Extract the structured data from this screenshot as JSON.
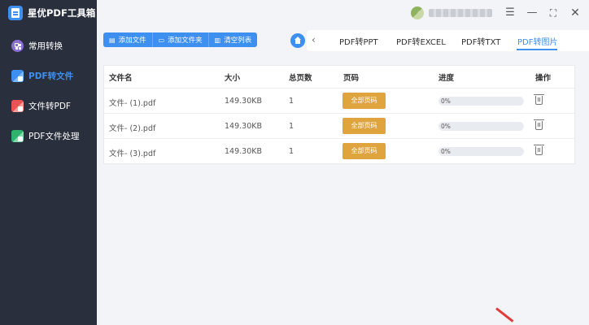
{
  "app": {
    "title": "星优PDF工具箱"
  },
  "sidebar": {
    "items": [
      {
        "label": "常用转换",
        "icon": "grid-icon"
      },
      {
        "label": "PDF转文件",
        "icon": "pdf-to-file-icon",
        "active": true
      },
      {
        "label": "文件转PDF",
        "icon": "file-to-pdf-icon"
      },
      {
        "label": "PDF文件处理",
        "icon": "pdf-process-icon"
      }
    ]
  },
  "window_controls": [
    "settings-icon",
    "minimize-icon",
    "maximize-icon",
    "close-icon"
  ],
  "toolbar": {
    "add_file": "添加文件",
    "add_folder": "添加文件夹",
    "clear_list": "清空列表"
  },
  "tabs": [
    "PDF转PPT",
    "PDF转EXCEL",
    "PDF转TXT",
    "PDF转图片"
  ],
  "active_tab": "PDF转图片",
  "table": {
    "headers": [
      "文件名",
      "大小",
      "总页数",
      "页码",
      "进度",
      "操作"
    ],
    "rows": [
      {
        "name": "文件- (1).pdf",
        "size": "149.30KB",
        "pages": "1",
        "page_btn": "全部页码",
        "progress_text": "0%",
        "progress": 0
      },
      {
        "name": "文件- (2).pdf",
        "size": "149.30KB",
        "pages": "1",
        "page_btn": "全部页码",
        "progress_text": "0%",
        "progress": 0
      },
      {
        "name": "文件- (3).pdf",
        "size": "149.30KB",
        "pages": "1",
        "page_btn": "全部页码",
        "progress_text": "0%",
        "progress": 0
      }
    ]
  },
  "colors": {
    "accent": "#3d8ff0",
    "sidebar": "#2a2f3d",
    "page_button": "#e0a43f",
    "annotation": "#e23b3b"
  }
}
